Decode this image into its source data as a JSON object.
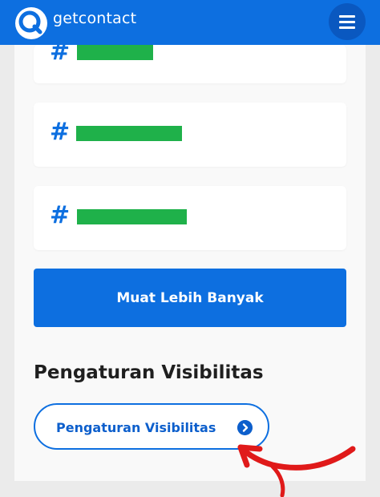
{
  "header": {
    "logo_text": "getcontact",
    "logo_icon": "getcontact-logo-icon",
    "menu_icon": "hamburger-menu-icon",
    "brand_color": "#0d6fe0"
  },
  "tags": [
    {
      "symbol": "#",
      "value_hidden": true
    },
    {
      "symbol": "#",
      "value_hidden": true
    },
    {
      "symbol": "#",
      "value_hidden": true
    }
  ],
  "load_more": {
    "label": "Muat Lebih Banyak"
  },
  "visibility": {
    "heading": "Pengaturan Visibilitas",
    "button_label": "Pengaturan Visibilitas",
    "button_icon": "chevron-right-circle-icon"
  },
  "annotation": {
    "icon": "red-arrow-annotation",
    "color": "#e01a1a"
  }
}
